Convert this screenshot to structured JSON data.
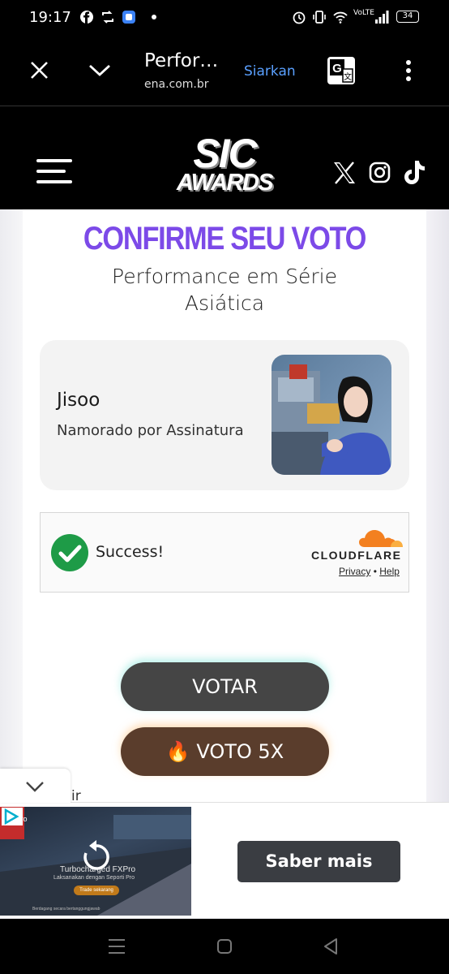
{
  "status_bar": {
    "time": "19:17",
    "battery": "34",
    "network": "VoLTE"
  },
  "browser": {
    "page_title": "Perfor…",
    "url": "ena.com.br",
    "cast_label": "Siarkan"
  },
  "site": {
    "logo_line1": "SIC",
    "logo_line2": "AWARDS"
  },
  "vote": {
    "heading": "CONFIRME SEU VOTO",
    "category_line1": "Performance em Série",
    "category_line2": "Asiática"
  },
  "nominee": {
    "name": "Jisoo",
    "work": "Namorado por Assinatura"
  },
  "captcha": {
    "status": "Success!",
    "provider": "CLOUDFLARE",
    "privacy": "Privacy",
    "separator": "•",
    "help": "Help"
  },
  "buttons": {
    "vote": "VOTAR",
    "vote5x": "🔥 VOTO 5X"
  },
  "ad": {
    "cta": "Saber mais",
    "brand": "FXPro",
    "headline": "Turbocharged FXPro",
    "subline": "Laksanakan dengan Seporti Pro",
    "small_button": "Trade sekarang",
    "disclaimer": "Berdagang secara bertanggungjawab",
    "cut_text": "ir"
  },
  "colors": {
    "accent": "#7c4ae8",
    "vote_button": "#454545",
    "vote5x_button": "#5a3d2c",
    "success_green": "#1e9b47",
    "cloudflare_orange": "#f38020"
  }
}
